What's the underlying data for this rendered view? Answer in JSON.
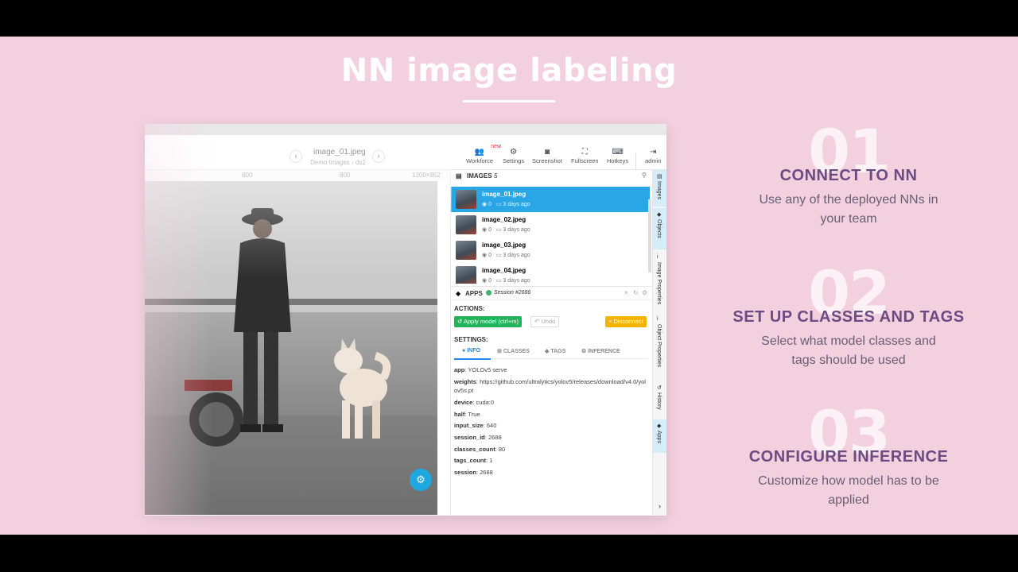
{
  "hero": {
    "title": "NN image labeling"
  },
  "app": {
    "image_title": "image_01.jpeg",
    "breadcrumb": "Demo Images › ds2",
    "nav_prev": "‹",
    "nav_next": "›",
    "toolbar": [
      {
        "label": "Workforce",
        "icon": "users-icon",
        "badge": "new"
      },
      {
        "label": "Settings",
        "icon": "gear-icon"
      },
      {
        "label": "Screenshot",
        "icon": "camera-icon"
      },
      {
        "label": "Fullscreen",
        "icon": "fullscreen-icon"
      },
      {
        "label": "Hotkeys",
        "icon": "keyboard-icon"
      },
      {
        "label": "admin",
        "icon": "logout-icon"
      }
    ],
    "ruler": {
      "mark_a": "600",
      "mark_b": "900",
      "size": "1200×952"
    },
    "images_header": {
      "title": "IMAGES",
      "count": "5"
    },
    "images": [
      {
        "name": "image_01.jpeg",
        "objects": "0",
        "date": "3 days ago",
        "active": true
      },
      {
        "name": "image_02.jpeg",
        "objects": "0",
        "date": "3 days ago",
        "active": false
      },
      {
        "name": "image_03.jpeg",
        "objects": "0",
        "date": "3 days ago",
        "active": false
      },
      {
        "name": "image_04.jpeg",
        "objects": "0",
        "date": "3 days ago",
        "active": false
      }
    ],
    "apps": {
      "title": "APPS",
      "session": "Session #2686"
    },
    "actions_label": "ACTIONS:",
    "buttons": {
      "apply": "Apply model (ctrl+m)",
      "undo": "Undo",
      "disconnect": "Disconnect"
    },
    "settings_label": "SETTINGS:",
    "tabs": [
      "INFO",
      "CLASSES",
      "TAGS",
      "INFERENCE"
    ],
    "info": [
      {
        "key": "app",
        "value": "YOLOv5 serve"
      },
      {
        "key": "weights",
        "value": "https://github.com/ultralytics/yolov5/releases/download/v4.0/yolov5s.pt"
      },
      {
        "key": "device",
        "value": "cuda:0"
      },
      {
        "key": "half",
        "value": "True"
      },
      {
        "key": "input_size",
        "value": "640"
      },
      {
        "key": "session_id",
        "value": "2688"
      },
      {
        "key": "classes_count",
        "value": "80"
      },
      {
        "key": "tags_count",
        "value": "1"
      },
      {
        "key": "session",
        "value": "2688"
      }
    ],
    "side_tabs": [
      "Images",
      "Objects",
      "Image Properties",
      "Object Properties",
      "History",
      "Apps"
    ]
  },
  "steps": [
    {
      "num": "01",
      "title": "CONNECT TO NN",
      "desc": "Use any of the deployed NNs in your team"
    },
    {
      "num": "02",
      "title": "SET UP CLASSES AND TAGS",
      "desc": "Select what model classes and tags  should be used"
    },
    {
      "num": "03",
      "title": "CONFIGURE INFERENCE",
      "desc": "Customize how model has to be applied"
    }
  ]
}
